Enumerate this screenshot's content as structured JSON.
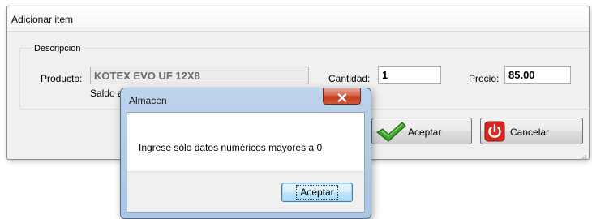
{
  "main_window": {
    "title": "Adicionar item",
    "group_title": "Descripcion",
    "producto_label": "Producto:",
    "producto_value": "KOTEX EVO UF 12X8",
    "saldo_label": "Saldo a",
    "cantidad_label": "Cantidad:",
    "cantidad_value": "1",
    "precio_label": "Precio:",
    "precio_value": "85.00",
    "aceptar_label": "Aceptar",
    "cancelar_label": "Cancelar",
    "icons": {
      "aceptar": "checkmark-icon",
      "cancelar": "power-icon",
      "grip": "resize-grip-icon"
    },
    "colors": {
      "accept_green": "#3aa22a",
      "cancel_red": "#d8261e"
    }
  },
  "dialog": {
    "title": "Almacen",
    "message": "Ingrese sólo datos numéricos mayores a 0",
    "ok_label": "Aceptar",
    "icons": {
      "close": "close-icon"
    },
    "colors": {
      "close_red": "#c43b1e"
    }
  }
}
